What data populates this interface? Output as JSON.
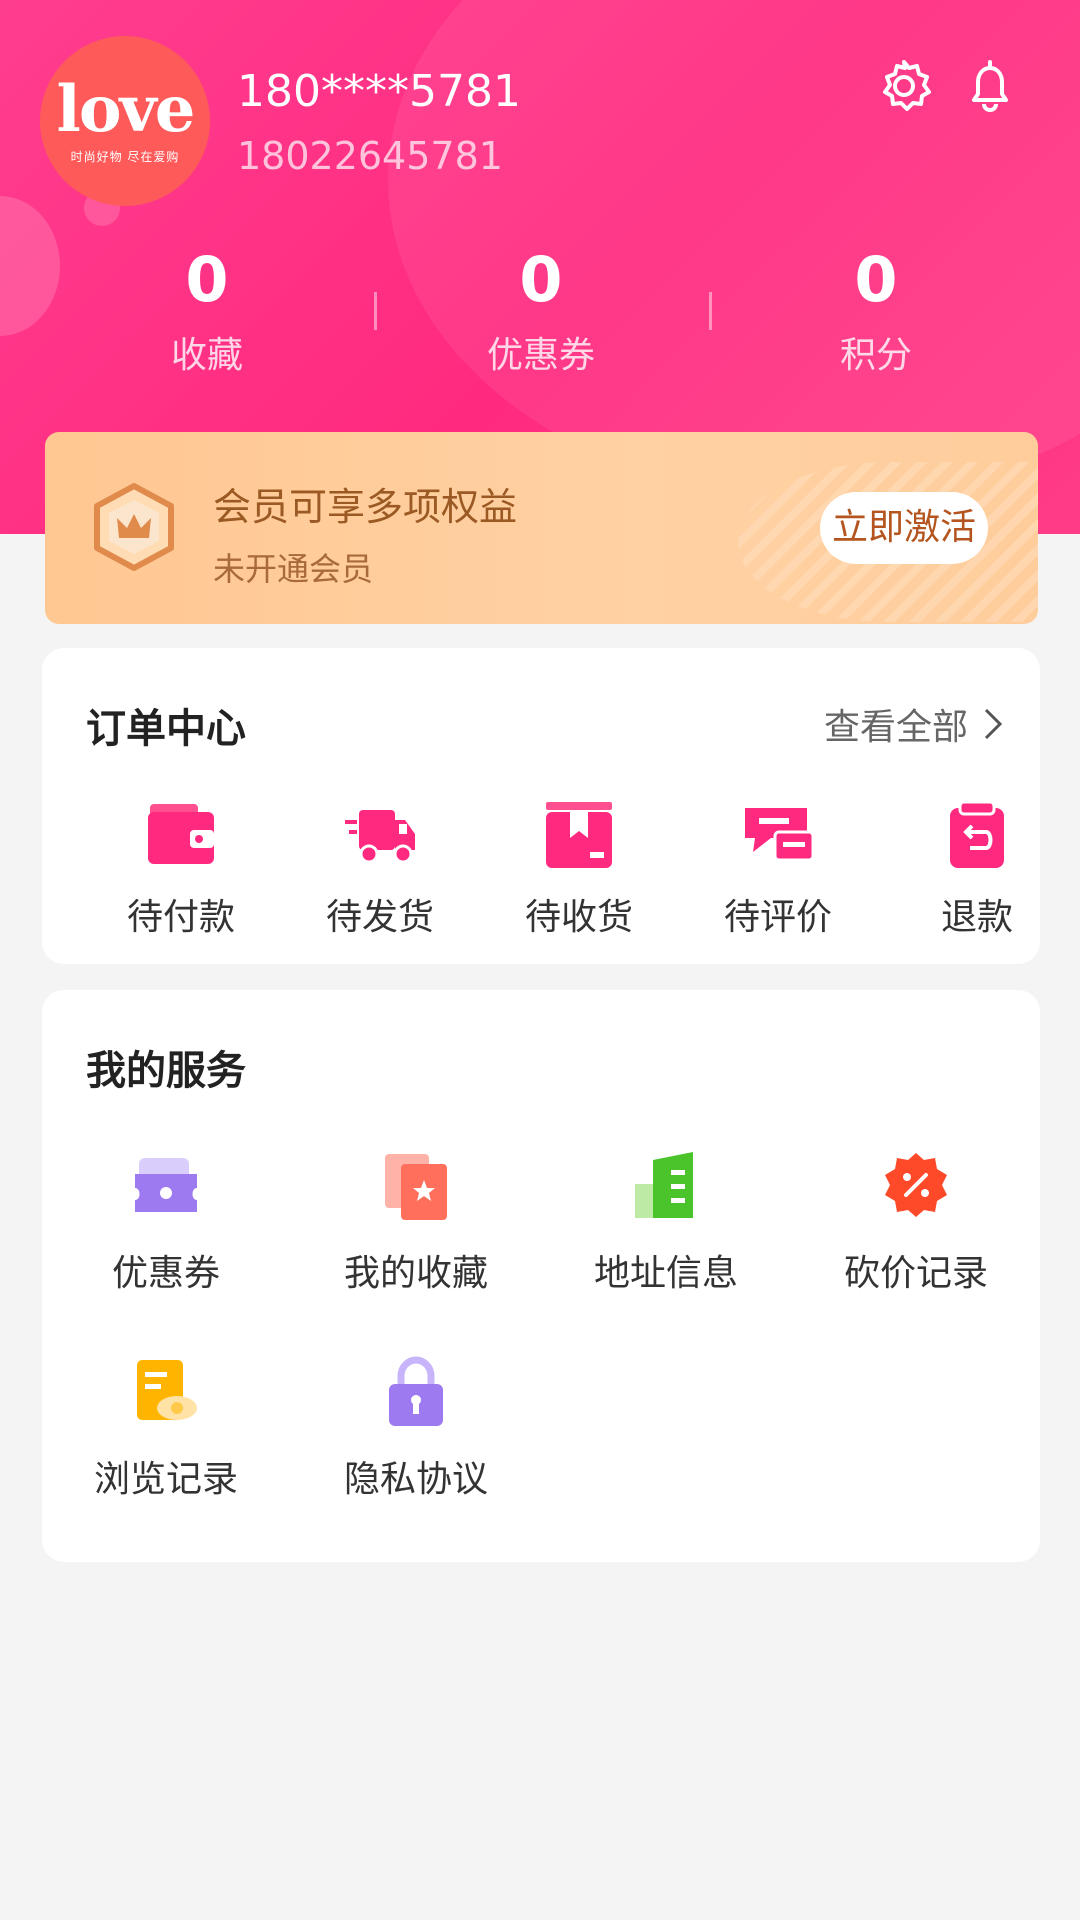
{
  "profile": {
    "logo_text": "love",
    "logo_subtitle": "时尚好物 尽在爱购",
    "username": "180****5781",
    "phone": "18022645781"
  },
  "stats": [
    {
      "value": "0",
      "label": "收藏"
    },
    {
      "value": "0",
      "label": "优惠券"
    },
    {
      "value": "0",
      "label": "积分"
    }
  ],
  "vip": {
    "title": "会员可享多项权益",
    "subtitle": "未开通会员",
    "button": "立即激活"
  },
  "orders": {
    "title": "订单中心",
    "view_all": "查看全部",
    "items": [
      {
        "label": "待付款",
        "icon": "wallet-icon"
      },
      {
        "label": "待发货",
        "icon": "truck-icon"
      },
      {
        "label": "待收货",
        "icon": "package-icon"
      },
      {
        "label": "待评价",
        "icon": "comment-icon"
      },
      {
        "label": "退款",
        "icon": "refund-icon"
      }
    ]
  },
  "services": {
    "title": "我的服务",
    "items": [
      {
        "label": "优惠券",
        "icon": "coupon-icon"
      },
      {
        "label": "我的收藏",
        "icon": "favorites-icon"
      },
      {
        "label": "地址信息",
        "icon": "building-icon"
      },
      {
        "label": "砍价记录",
        "icon": "discount-icon"
      },
      {
        "label": "浏览记录",
        "icon": "history-icon"
      },
      {
        "label": "隐私协议",
        "icon": "lock-icon"
      }
    ]
  },
  "colors": {
    "brand_pink": "#ff2a7f",
    "vip_gold": "#ffcd9c",
    "vip_text": "#9b5a24",
    "accent_red": "#ff4a6e"
  }
}
